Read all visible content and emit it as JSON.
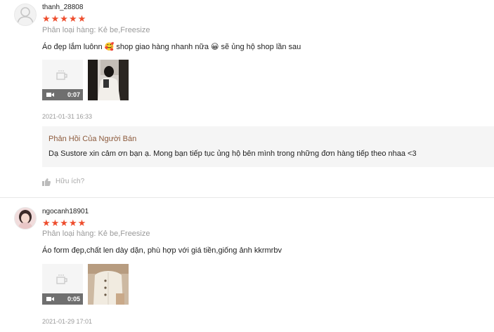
{
  "reviews": [
    {
      "username": "thanh_28808",
      "stars": "★★★★★",
      "rating": 5,
      "variation": "Phân loại hàng: Kẻ be,Freesize",
      "content": "Áo đẹp lắm luônn 🥰 shop giao hàng nhanh nữa 😀 sẽ ủng hộ shop lần sau",
      "video_duration": "0:07",
      "timestamp": "2021-01-31 16:33",
      "seller_reply": {
        "title": "Phản Hồi Của Người Bán",
        "text": "Dạ Sustore xin cảm ơn bạn ạ. Mong bạn tiếp tục ủng hộ bên mình trong những đơn hàng tiếp theo nhaa <3"
      },
      "helpful_label": "Hữu ích?"
    },
    {
      "username": "ngocanh18901",
      "stars": "★★★★★",
      "rating": 5,
      "variation": "Phân loại hàng: Kẻ be,Freesize",
      "content": "Áo form đẹp,chất len dày dặn, phù hợp với giá tiền,giống ảnh kkrmrbv",
      "video_duration": "0:05",
      "timestamp": "2021-01-29 17:01"
    }
  ],
  "colors": {
    "star": "#ee4d2d",
    "seller_reply_title": "#8c5a3c",
    "muted_text": "#9a9a9a"
  }
}
